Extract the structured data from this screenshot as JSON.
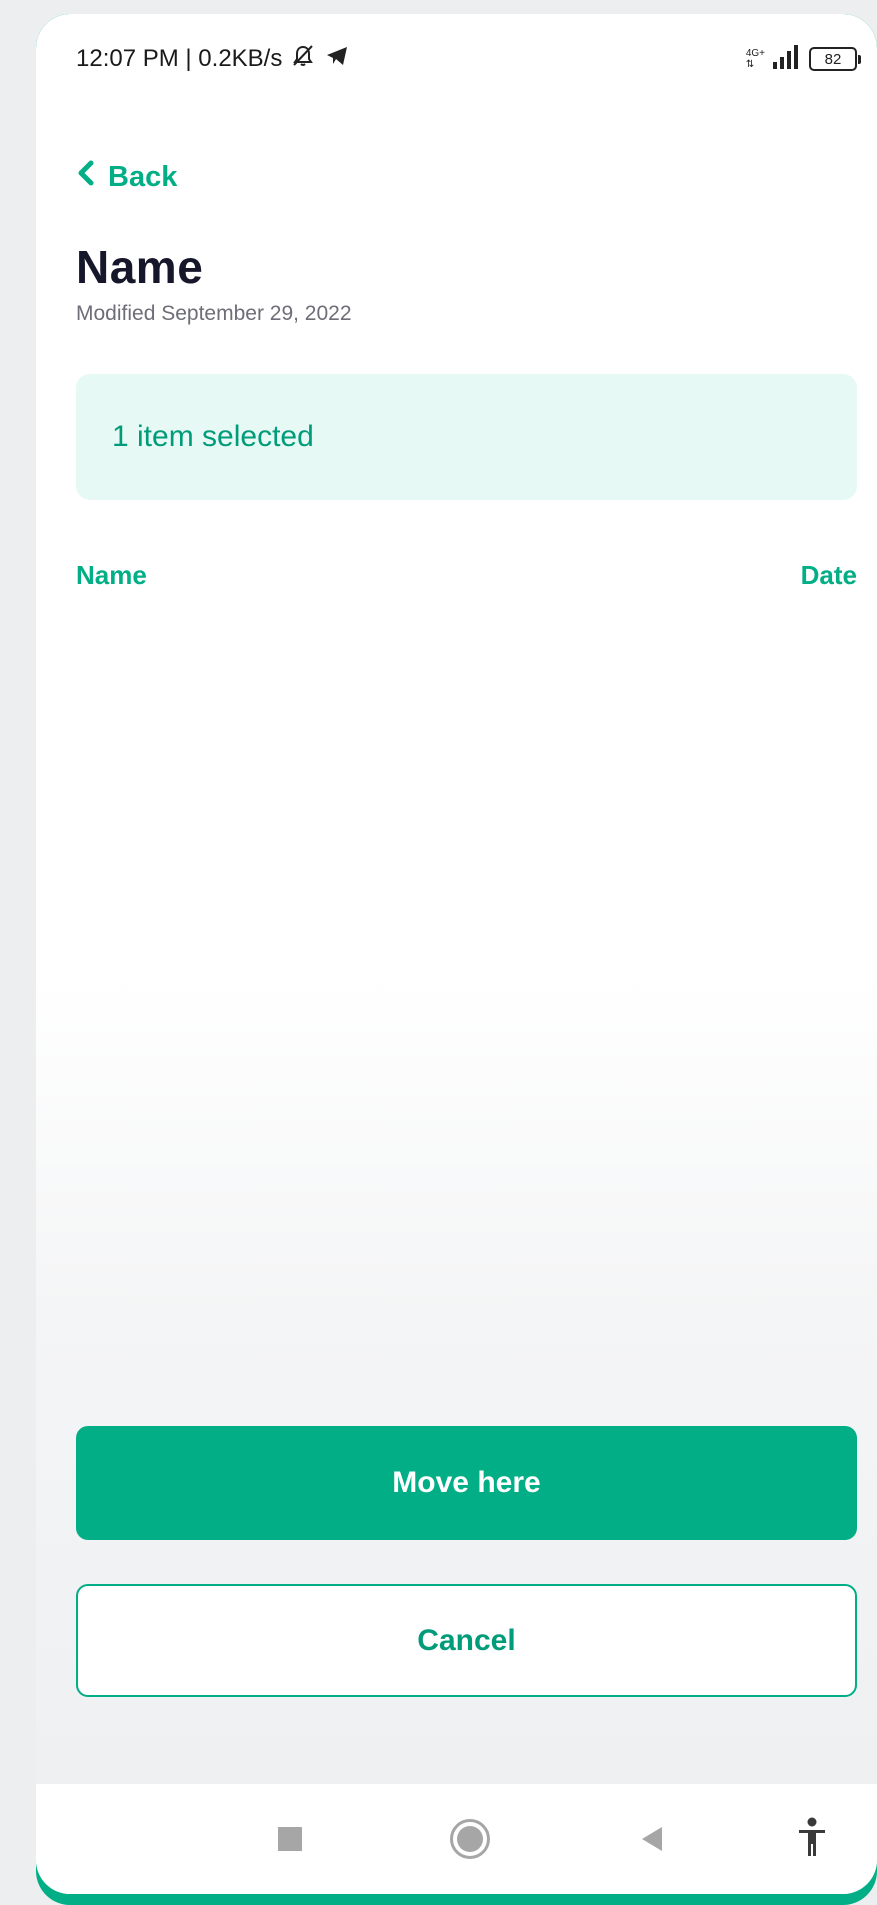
{
  "status_bar": {
    "time_speed": "12:07 PM | 0.2KB/s",
    "network_type": "4G+",
    "battery_level": "82",
    "icons": [
      "muted-bell-icon",
      "telegram-icon",
      "signal-icon",
      "battery-icon"
    ]
  },
  "header": {
    "back_label": "Back",
    "title": "Name",
    "modified": "Modified September 29, 2022"
  },
  "selection": {
    "text": "1 item selected"
  },
  "columns": {
    "name": "Name",
    "date": "Date"
  },
  "actions": {
    "move_label": "Move here",
    "cancel_label": "Cancel"
  },
  "nav_bar": {
    "icons": [
      "recents-icon",
      "home-icon",
      "back-icon",
      "accessibility-icon"
    ]
  },
  "colors": {
    "accent": "#01ae86",
    "title": "#17172b",
    "banner_bg": "#e6f9f4"
  }
}
